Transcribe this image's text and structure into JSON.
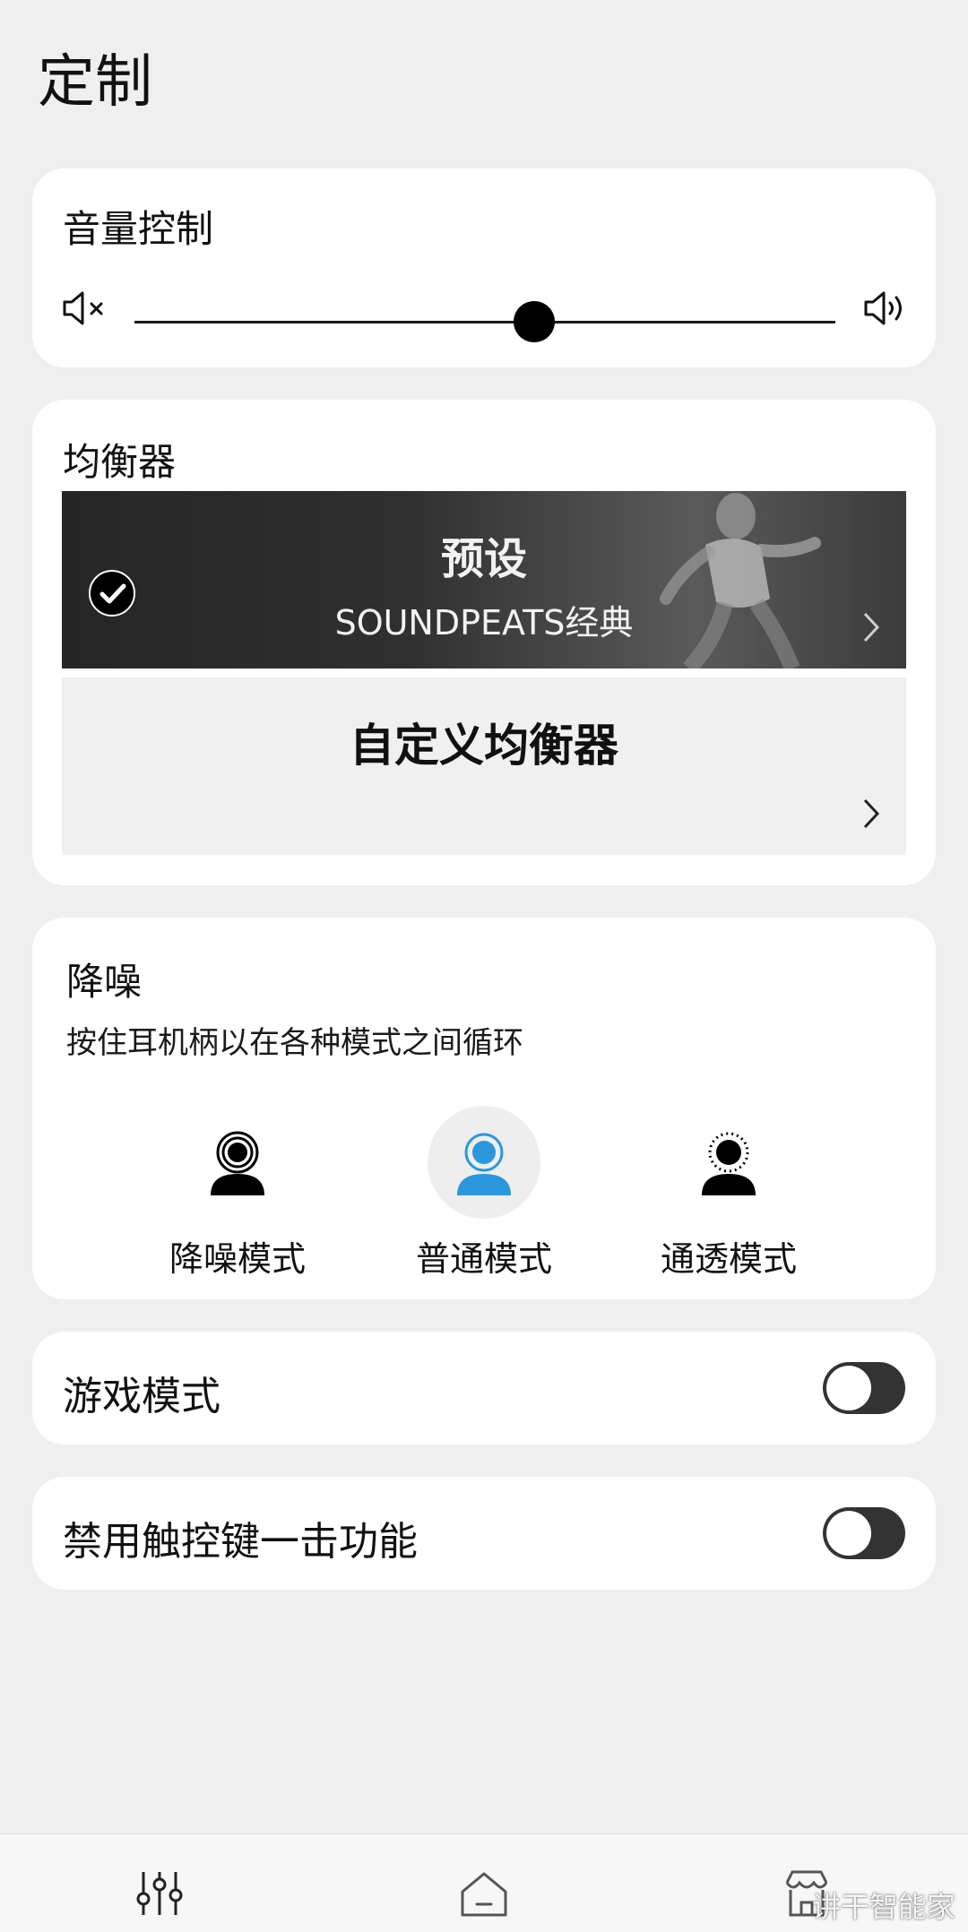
{
  "page": {
    "title": "定制"
  },
  "volume": {
    "label": "音量控制",
    "level_percent": 57,
    "mute_icon": "volume-mute-icon",
    "max_icon": "volume-up-icon"
  },
  "equalizer": {
    "label": "均衡器",
    "preset": {
      "title": "预设",
      "subtitle": "SOUNDPEATS经典",
      "selected": true
    },
    "custom": {
      "title": "自定义均衡器"
    }
  },
  "noise": {
    "label": "降噪",
    "description": "按住耳机柄以在各种模式之间循环",
    "active_color": "#2b97dd",
    "modes": [
      {
        "label": "降噪模式",
        "icon": "noise-cancelling-icon",
        "active": false
      },
      {
        "label": "普通模式",
        "icon": "normal-mode-icon",
        "active": true
      },
      {
        "label": "通透模式",
        "icon": "transparency-icon",
        "active": false
      }
    ]
  },
  "game_mode": {
    "label": "游戏模式",
    "enabled": false
  },
  "touch_disable": {
    "label": "禁用触控键一击功能",
    "enabled": false
  },
  "bottom_nav": {
    "items": [
      {
        "icon": "equalizer-sliders-icon"
      },
      {
        "icon": "home-icon"
      },
      {
        "icon": "store-icon"
      }
    ]
  },
  "watermark": "讲干智能家"
}
